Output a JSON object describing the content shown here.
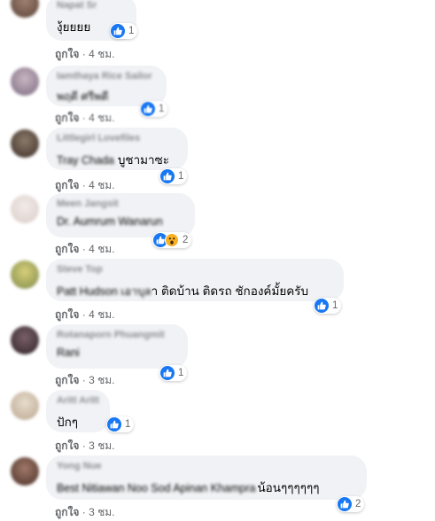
{
  "like_label": "ถูกใจ",
  "separator": "·",
  "comments": [
    {
      "author": "Napat Sr",
      "blurred_prefix": "",
      "text": "งุ้ยยยย",
      "reaction_count": "1",
      "time": "4 ชม."
    },
    {
      "author": "Iamthaya Rice Sailor",
      "blurred_prefix": "",
      "text": "พฤดี ศรีพดี",
      "reaction_count": "1",
      "time": "4 ชม."
    },
    {
      "author": "Littlegirl Lovefiles",
      "blurred_prefix": "Tray Chada",
      "text": "บูชามาซะ",
      "reaction_count": "1",
      "time": "4 ชม."
    },
    {
      "author": "Meen Jangsit",
      "blurred_prefix": "Dr. Aumrum Wanarun",
      "text": "",
      "reaction_count": "2",
      "time": "4 ชม."
    },
    {
      "author": "Steve Top",
      "blurred_prefix": "Patt Hudson เอาบุล",
      "text": "า ติดบ้าน ติดรถ ชักองค์มั้ยครับ",
      "reaction_count": "1",
      "time": "4 ชม."
    },
    {
      "author": "Rotanaporn Phuangmit",
      "blurred_prefix": "Rani",
      "text": "",
      "reaction_count": "1",
      "time": "3 ชม."
    },
    {
      "author": "Aritt Aritt",
      "blurred_prefix": "",
      "text": "ปักๆ",
      "reaction_count": "1",
      "time": "3 ชม."
    },
    {
      "author": "Yong Nue",
      "blurred_prefix": "Best Nitiawan Noo Sod Apinan Khampra",
      "text": "น้อนๆๆๆๆๆๆ",
      "reaction_count": "2",
      "time": "3 ชม."
    }
  ],
  "colors": {
    "like_blue": "#1877f2",
    "bubble": "#f0f2f5",
    "meta": "#65676b",
    "text": "#050505"
  },
  "icons": {
    "like": "thumbs-up-icon",
    "wow": "wow-face-icon"
  }
}
